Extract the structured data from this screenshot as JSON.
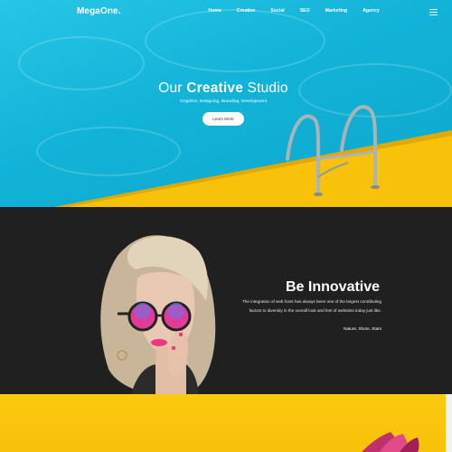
{
  "brand": {
    "logo": "MegaOne."
  },
  "nav": {
    "items": [
      "Home",
      "Creative",
      "Social",
      "SEO",
      "Marketing",
      "Agency"
    ]
  },
  "hero": {
    "title_light": "Our",
    "title_bold": "Creative",
    "title_tail": "Studio",
    "subtitle": "Graphics, Designing, Branding, Development",
    "button_label": "Learn More"
  },
  "innovative": {
    "title_light": "Be",
    "title_bold": "Innovative",
    "body": "The integration of web fonts has always been one of the largest contributing factors to diversity in the overall look and feel of websites today just like.",
    "tags": "Nature, Shore, Stars"
  },
  "icons": {
    "menu": "hamburger-menu-icon"
  },
  "colors": {
    "pool": "#18b8dc",
    "deck": "#f8c10a",
    "dark": "#202020",
    "accent": "#f0357f"
  }
}
